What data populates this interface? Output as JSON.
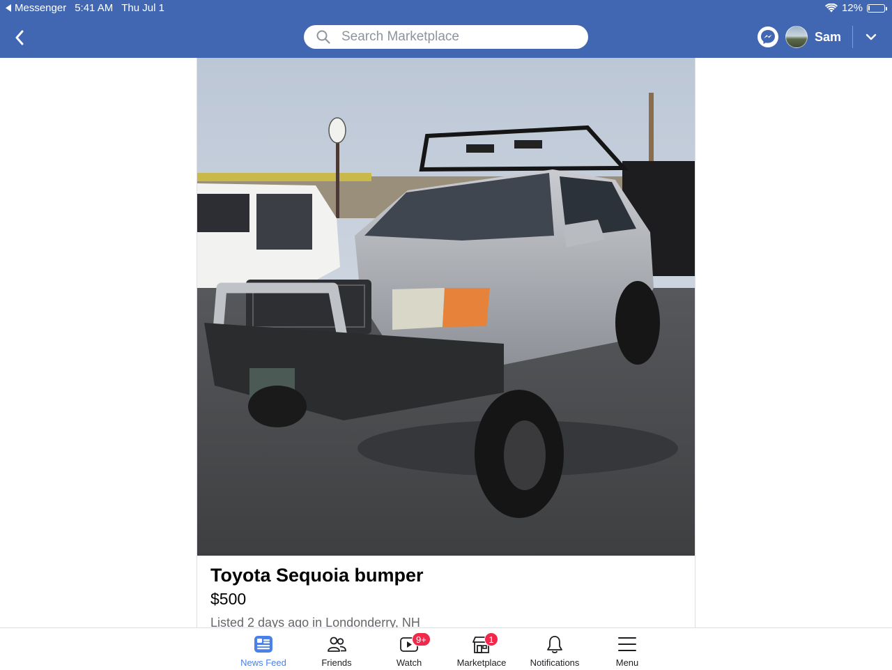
{
  "status_bar": {
    "back_app": "Messenger",
    "time": "5:41 AM",
    "date": "Thu Jul 1",
    "battery": "12%",
    "battery_level": 0.12
  },
  "header": {
    "search_placeholder": "Search Marketplace",
    "user_name": "Sam",
    "icons": [
      "back-arrow-icon",
      "search-icon",
      "messenger-icon",
      "chevron-down-icon"
    ],
    "bar_color": "#4267b2"
  },
  "listing": {
    "title": "Toyota Sequoia bumper",
    "price": "$500",
    "listed": "Listed 2 days ago in Londonderry, NH",
    "photo_subject": "silver Toyota Sequoia V8 with roof rack and off-road bumper"
  },
  "tabs": [
    {
      "label": "News Feed",
      "icon": "news-feed-icon",
      "active": true,
      "badge": ""
    },
    {
      "label": "Friends",
      "icon": "friends-icon",
      "active": false,
      "badge": ""
    },
    {
      "label": "Watch",
      "icon": "watch-icon",
      "active": false,
      "badge": "9+"
    },
    {
      "label": "Marketplace",
      "icon": "marketplace-icon",
      "active": false,
      "badge": "1"
    },
    {
      "label": "Notifications",
      "icon": "bell-icon",
      "active": false,
      "badge": ""
    },
    {
      "label": "Menu",
      "icon": "menu-icon",
      "active": false,
      "badge": ""
    }
  ],
  "colors": {
    "active_tab": "#4a80e8",
    "badge": "#f02849"
  }
}
